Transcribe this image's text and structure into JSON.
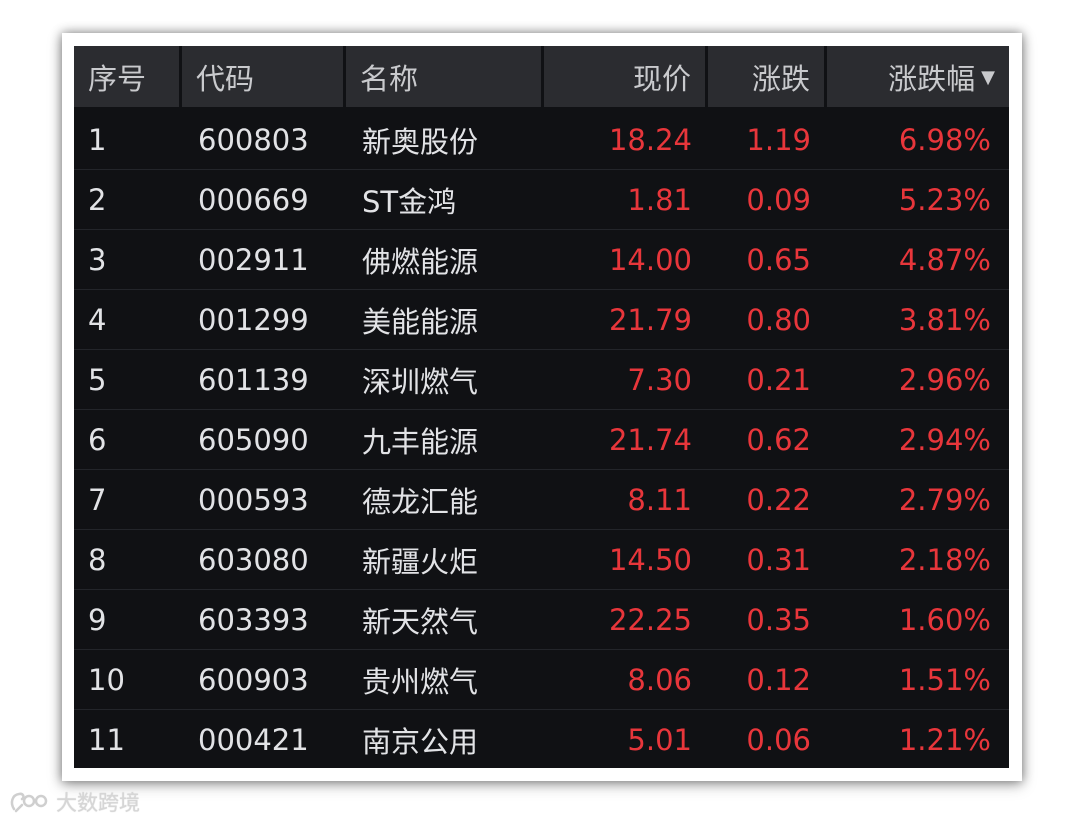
{
  "table": {
    "headers": {
      "idx": "序号",
      "code": "代码",
      "name": "名称",
      "price": "现价",
      "change": "涨跌",
      "pct": "涨跌幅",
      "sort_indicator": "▼"
    },
    "rows": [
      {
        "idx": "1",
        "code": "600803",
        "name": "新奥股份",
        "price": "18.24",
        "change": "1.19",
        "pct": "6.98%"
      },
      {
        "idx": "2",
        "code": "000669",
        "name": "ST金鸿",
        "price": "1.81",
        "change": "0.09",
        "pct": "5.23%"
      },
      {
        "idx": "3",
        "code": "002911",
        "name": "佛燃能源",
        "price": "14.00",
        "change": "0.65",
        "pct": "4.87%"
      },
      {
        "idx": "4",
        "code": "001299",
        "name": "美能能源",
        "price": "21.79",
        "change": "0.80",
        "pct": "3.81%"
      },
      {
        "idx": "5",
        "code": "601139",
        "name": "深圳燃气",
        "price": "7.30",
        "change": "0.21",
        "pct": "2.96%"
      },
      {
        "idx": "6",
        "code": "605090",
        "name": "九丰能源",
        "price": "21.74",
        "change": "0.62",
        "pct": "2.94%"
      },
      {
        "idx": "7",
        "code": "000593",
        "name": "德龙汇能",
        "price": "8.11",
        "change": "0.22",
        "pct": "2.79%"
      },
      {
        "idx": "8",
        "code": "603080",
        "name": "新疆火炬",
        "price": "14.50",
        "change": "0.31",
        "pct": "2.18%"
      },
      {
        "idx": "9",
        "code": "603393",
        "name": "新天然气",
        "price": "22.25",
        "change": "0.35",
        "pct": "1.60%"
      },
      {
        "idx": "10",
        "code": "600903",
        "name": "贵州燃气",
        "price": "8.06",
        "change": "0.12",
        "pct": "1.51%"
      },
      {
        "idx": "11",
        "code": "000421",
        "name": "南京公用",
        "price": "5.01",
        "change": "0.06",
        "pct": "1.21%"
      }
    ]
  },
  "watermark": {
    "text": "大数跨境",
    "icon": "brand-logo-icon"
  },
  "colors": {
    "up": "#e8363b",
    "text": "#e2e3e6",
    "header_bg": "#2b2c30",
    "panel_bg": "#101114"
  }
}
